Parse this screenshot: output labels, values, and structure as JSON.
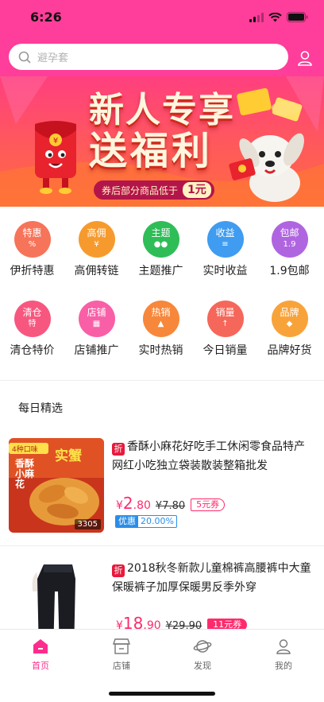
{
  "status": {
    "time": "6:26"
  },
  "search": {
    "placeholder": "避孕套"
  },
  "banner": {
    "line1": "新人专享",
    "line2": "送福利",
    "coupon_text": "券后部分商品低于",
    "coupon_value": "1元"
  },
  "categories": [
    {
      "icon_text": "特惠",
      "icon_sub": "%",
      "label": "伊折特惠",
      "color": "#f6745a"
    },
    {
      "icon_text": "高佣",
      "icon_sub": "¥",
      "label": "高佣转链",
      "color": "#f79a2e"
    },
    {
      "icon_text": "主题",
      "icon_sub": "●●",
      "label": "主题推广",
      "color": "#2fbd58"
    },
    {
      "icon_text": "收益",
      "icon_sub": "≡",
      "label": "实时收益",
      "color": "#3f9cf0"
    },
    {
      "icon_text": "包邮",
      "icon_sub": "1.9",
      "label": "1.9包邮",
      "color": "#b065e0"
    },
    {
      "icon_text": "清仓",
      "icon_sub": "特",
      "label": "清仓特价",
      "color": "#f7577f"
    },
    {
      "icon_text": "店铺",
      "icon_sub": "▦",
      "label": "店铺推广",
      "color": "#f85fa6"
    },
    {
      "icon_text": "热销",
      "icon_sub": "▲",
      "label": "实时热销",
      "color": "#f7873a"
    },
    {
      "icon_text": "销量",
      "icon_sub": "↑",
      "label": "今日销量",
      "color": "#f5675a"
    },
    {
      "icon_text": "品牌",
      "icon_sub": "◆",
      "label": "品牌好货",
      "color": "#f8a33a"
    }
  ],
  "section_title": "每日精选",
  "products": [
    {
      "tag": "折",
      "title": "香酥小麻花好吃手工休闲零食品特产网红小吃独立袋装散装整箱批发",
      "currency": "¥",
      "price_int": "2",
      "price_dec": ".80",
      "original_price": "¥7.80",
      "coupon": "5元券",
      "promo_label": "优惠",
      "promo_value": "20.00%",
      "image_count": "3305",
      "image_text1": "4种口味",
      "image_text2": "实蟹",
      "image_text3": "香酥小麻花"
    },
    {
      "tag": "折",
      "title": "2018秋冬新款儿童棉裤高腰裤中大童保暖裤子加厚保暖男反季外穿",
      "currency": "¥",
      "price_int": "18",
      "price_dec": ".90",
      "original_price": "¥29.90",
      "coupon": "11元券"
    }
  ],
  "tabs": [
    {
      "label": "首页",
      "icon": "home-icon",
      "active": true
    },
    {
      "label": "店铺",
      "icon": "shop-icon",
      "active": false
    },
    {
      "label": "发现",
      "icon": "discover-icon",
      "active": false
    },
    {
      "label": "我的",
      "icon": "profile-icon",
      "active": false
    }
  ],
  "colors": {
    "brand": "#fe3e9a",
    "price": "#ff2a6c",
    "promo": "#2a8ee8"
  }
}
